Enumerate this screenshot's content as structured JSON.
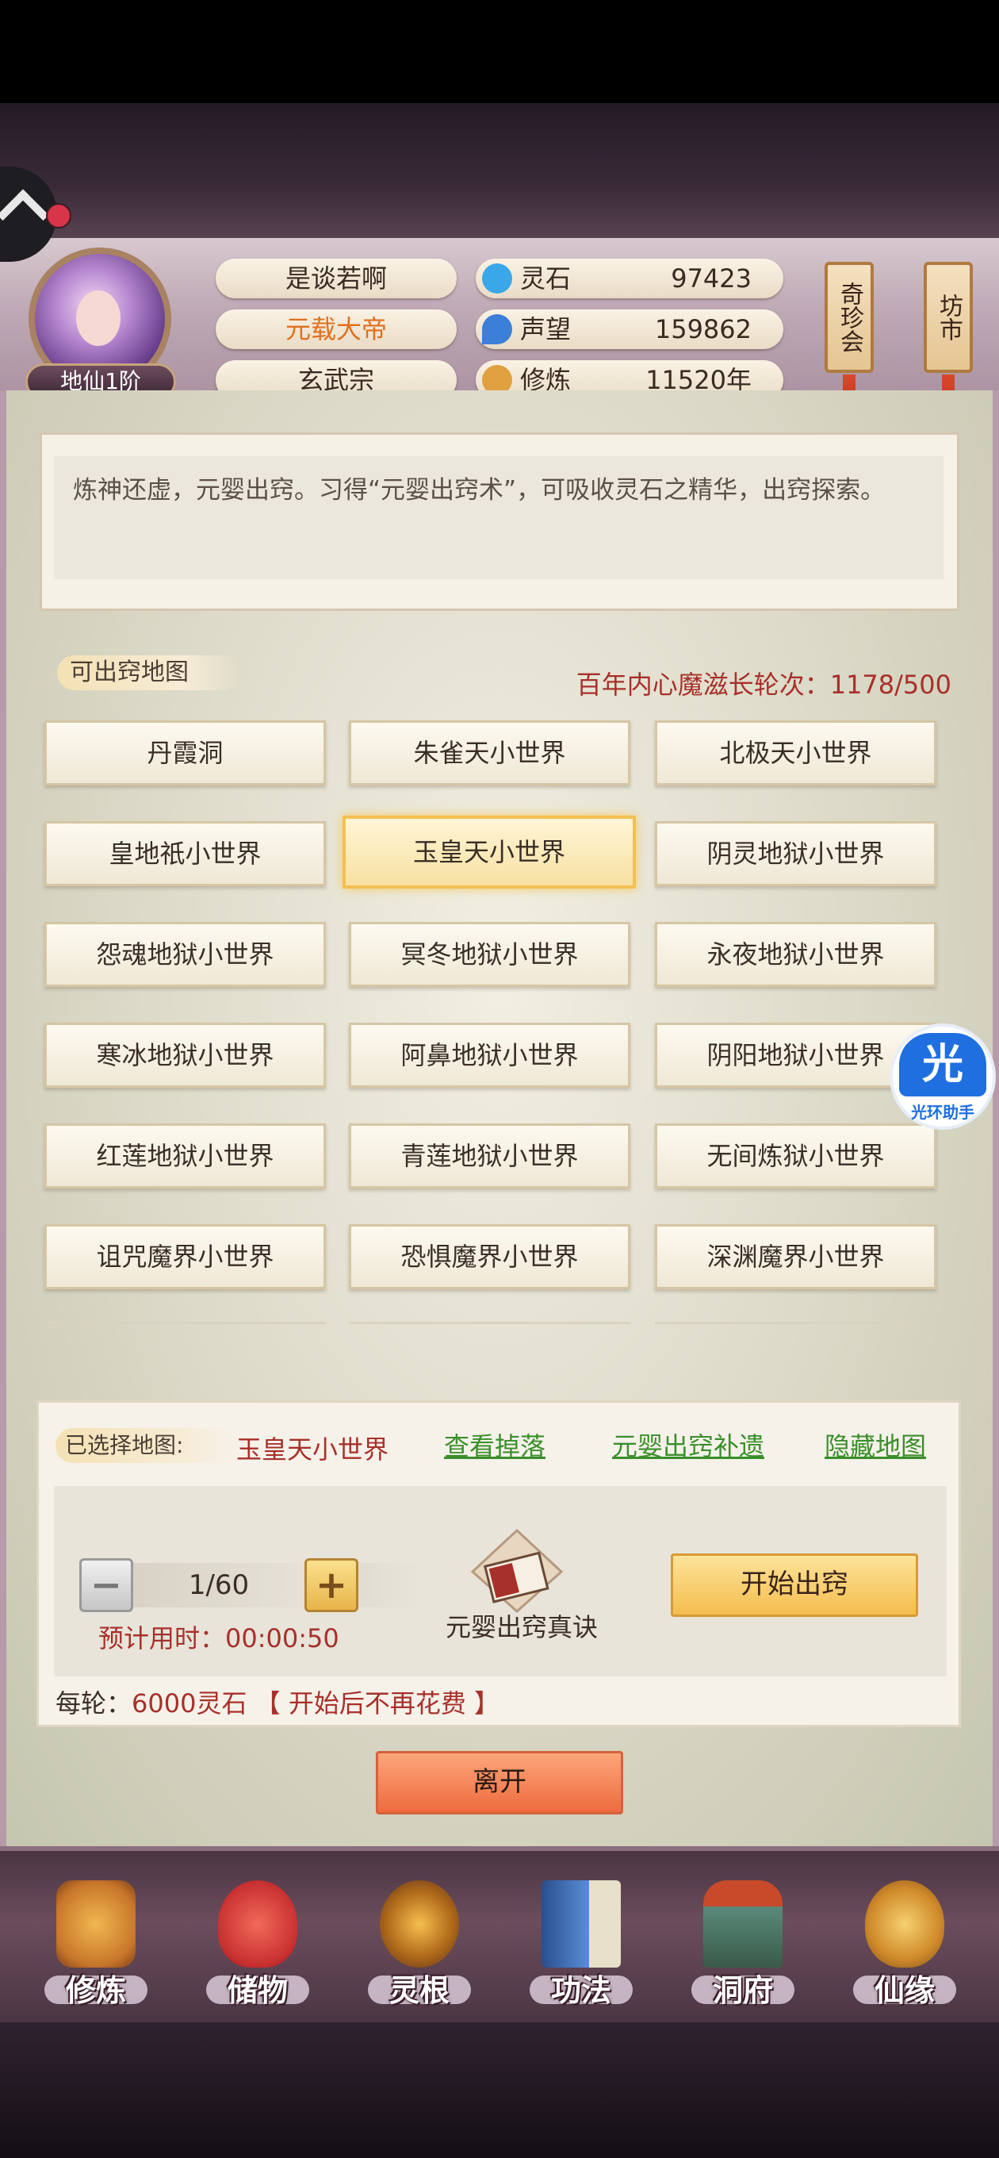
{
  "player": {
    "name": "是谈若啊",
    "title": "元载大帝",
    "sect": "玄武宗",
    "rank": "地仙1阶"
  },
  "stats": [
    {
      "label": "灵石",
      "value": "97423",
      "icon": "spirit-stone-icon",
      "color": "#3aa8e8"
    },
    {
      "label": "声望",
      "value": "159862",
      "icon": "prestige-drop-icon",
      "color": "#3c7fd8"
    },
    {
      "label": "修炼",
      "value": "11520年",
      "icon": "meditation-icon",
      "color": "#e0a040"
    }
  ],
  "shops": {
    "left": "奇珍会",
    "right": "坊市"
  },
  "description": "炼神还虚，元婴出窍。习得“元婴出窍术”，可吸收灵石之精华，出窍探索。",
  "map_section": {
    "label": "可出窍地图",
    "rounds_text": "百年内心魔滋长轮次：1178/500",
    "maps": [
      "丹霞洞",
      "朱雀天小世界",
      "北极天小世界",
      "皇地祇小世界",
      "玉皇天小世界",
      "阴灵地狱小世界",
      "怨魂地狱小世界",
      "冥冬地狱小世界",
      "永夜地狱小世界",
      "寒冰地狱小世界",
      "阿鼻地狱小世界",
      "阴阳地狱小世界",
      "红莲地狱小世界",
      "青莲地狱小世界",
      "无间炼狱小世界",
      "诅咒魔界小世界",
      "恐惧魔界小世界",
      "深渊魔界小世界"
    ],
    "selected_index": 4
  },
  "selection": {
    "label": "已选择地图:",
    "value": "玉皇天小世界",
    "links": [
      "查看掉落",
      "元婴出窍补遗",
      "隐藏地图"
    ],
    "quantity": "1/60",
    "eta": "预计用时：00:00:50",
    "book_label": "元婴出窍真诀",
    "start_button": "开始出窍",
    "cost_prefix": "每轮：",
    "cost_value": "6000灵石",
    "cost_note": "【 开始后不再花费 】"
  },
  "leave_button": "离开",
  "helper": {
    "glyph": "光",
    "label": "光环助手"
  },
  "nav": [
    {
      "label": "修炼",
      "icon": "cultivation-icon"
    },
    {
      "label": "储物",
      "icon": "storage-bag-icon"
    },
    {
      "label": "灵根",
      "icon": "spirit-root-icon"
    },
    {
      "label": "功法",
      "icon": "technique-book-icon"
    },
    {
      "label": "洞府",
      "icon": "cave-dwelling-icon"
    },
    {
      "label": "仙缘",
      "icon": "immortal-fate-icon"
    }
  ],
  "colors": {
    "accent_red": "#a8302a",
    "link_green": "#3a8f2a",
    "gold": "#f4bd4e"
  }
}
